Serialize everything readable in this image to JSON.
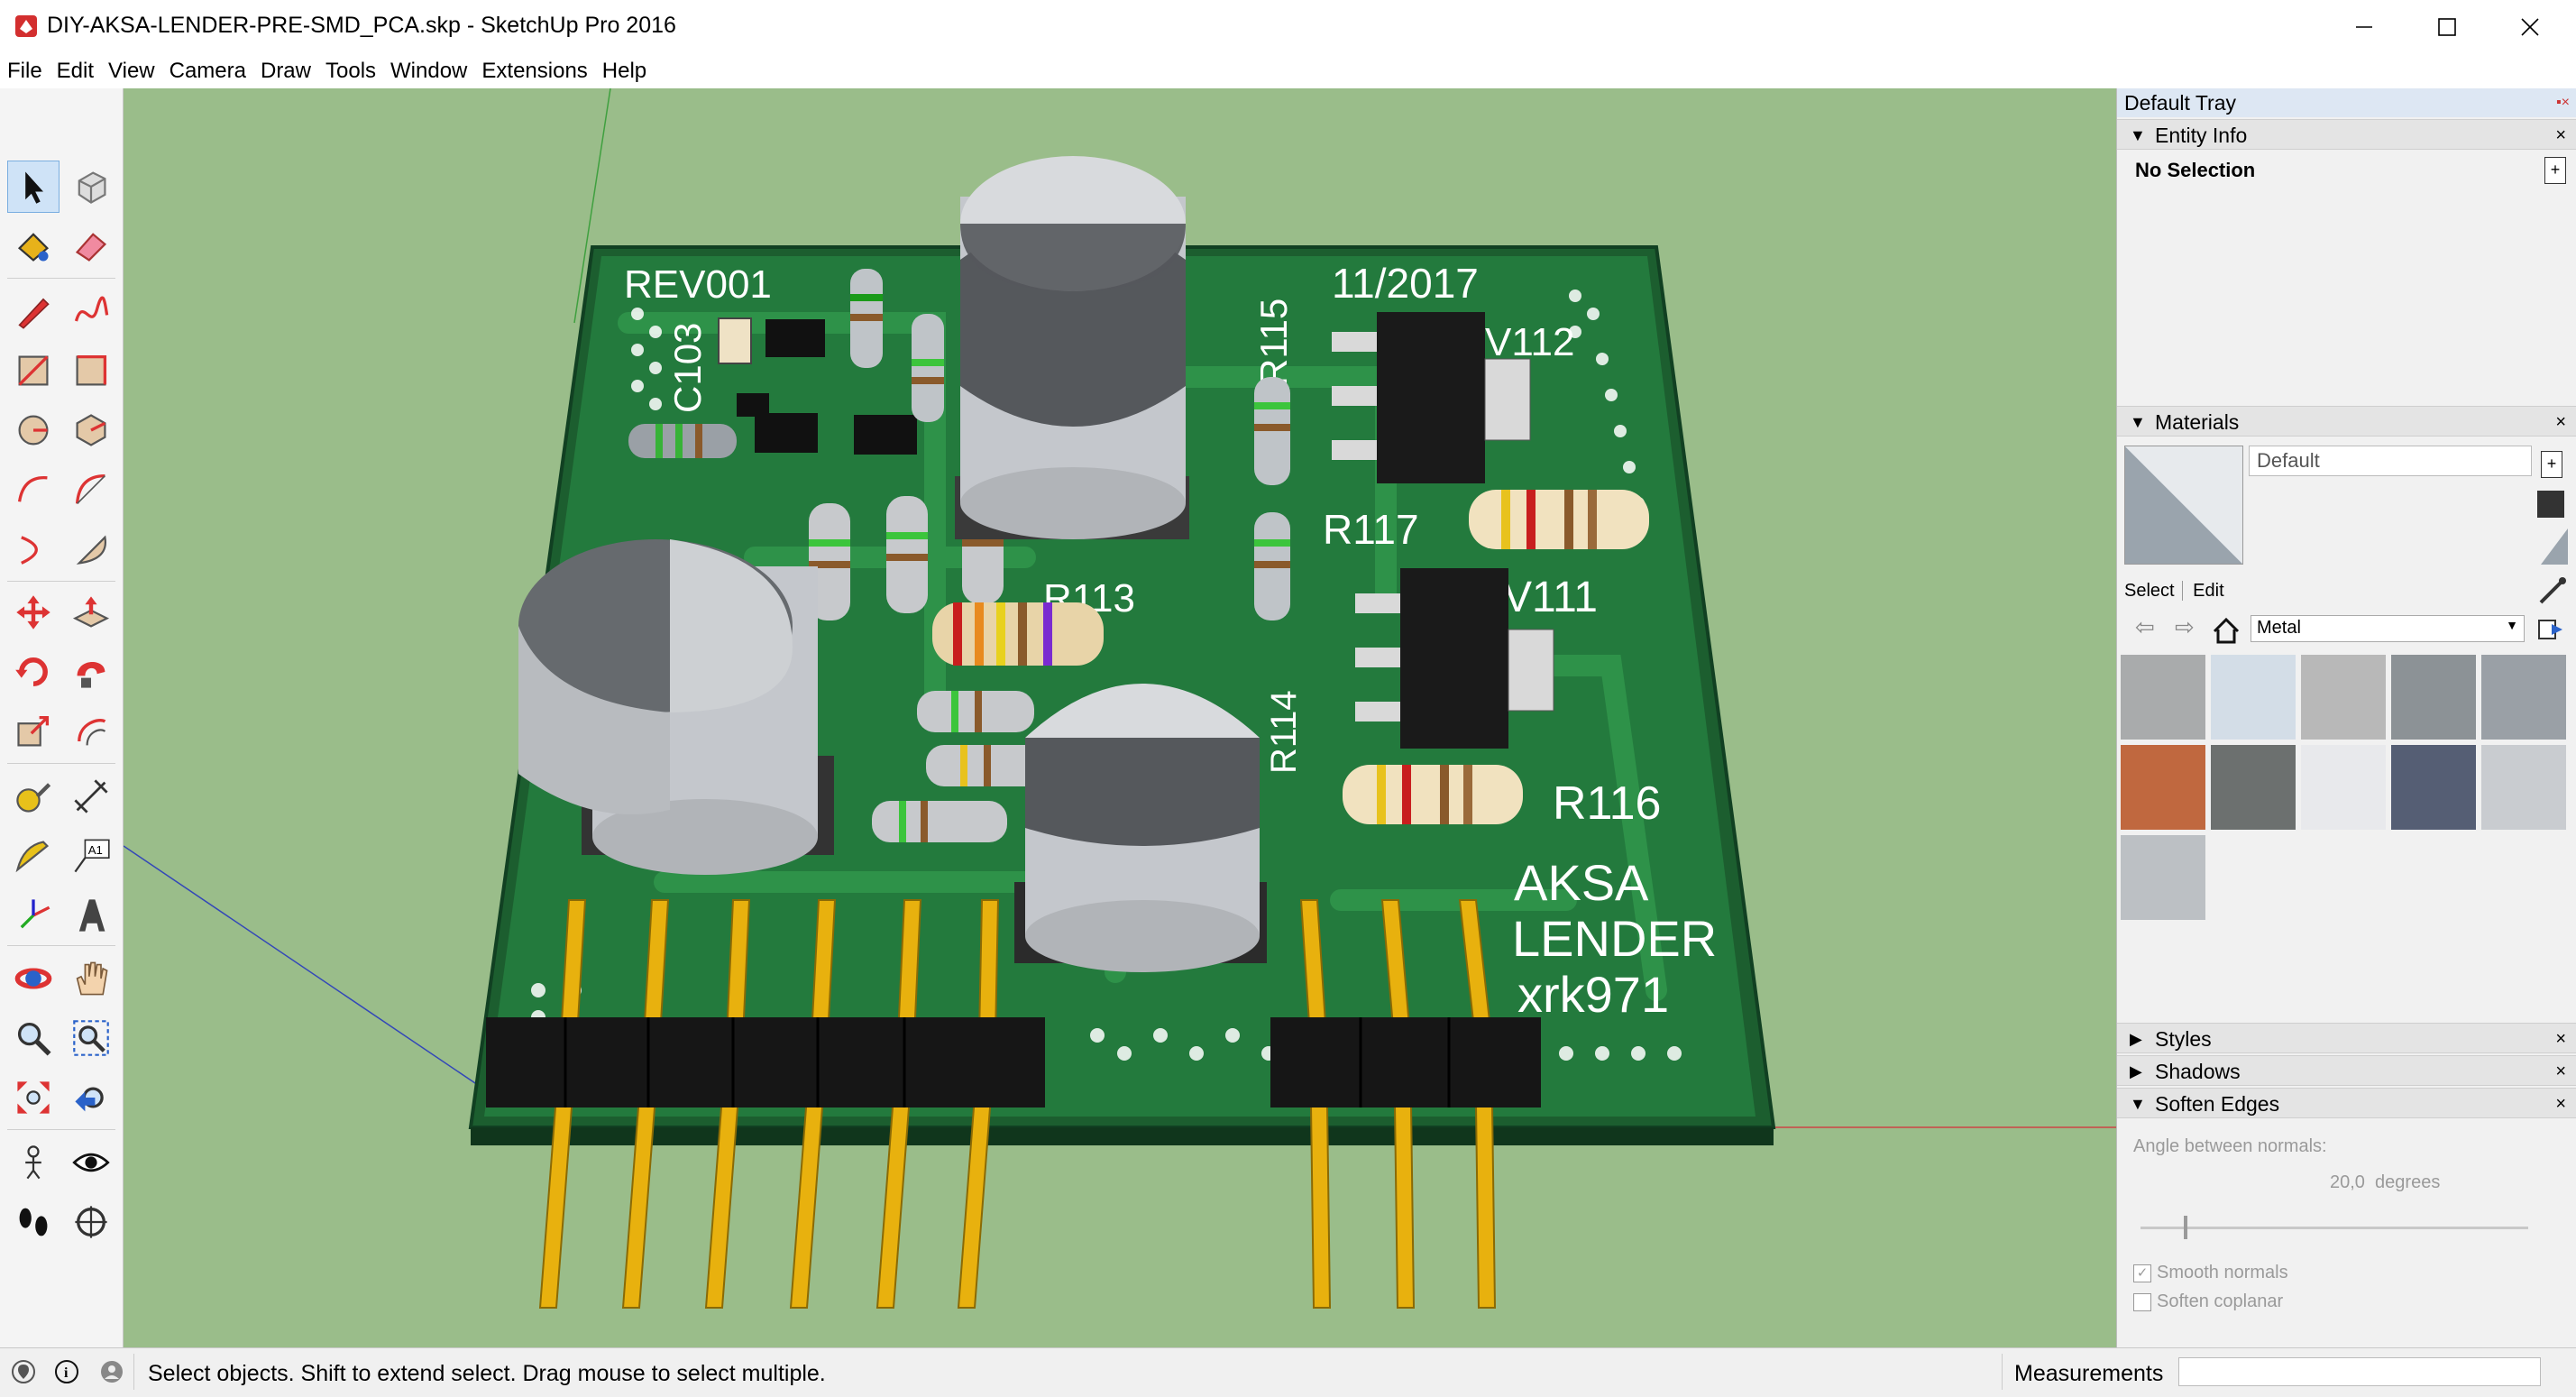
{
  "window": {
    "title": "DIY-AKSA-LENDER-PRE-SMD_PCA.skp - SketchUp Pro 2016",
    "minimize_glyph": "—",
    "maximize_glyph": "☐",
    "close_glyph": "✕"
  },
  "menu": [
    "File",
    "Edit",
    "View",
    "Camera",
    "Draw",
    "Tools",
    "Window",
    "Extensions",
    "Help"
  ],
  "toolbar": {
    "tools": [
      "select-tool",
      "component-tool",
      "paint-bucket-tool",
      "eraser-tool",
      "pencil-line-tool",
      "freehand-tool",
      "rectangle-tool",
      "rotated-rectangle-tool",
      "circle-tool",
      "polygon-tool",
      "arc-tool",
      "two-point-arc-tool",
      "three-point-arc-tool",
      "pie-tool",
      "move-tool",
      "push-pull-tool",
      "rotate-tool",
      "follow-me-tool",
      "scale-tool",
      "offset-tool",
      "tape-measure-tool",
      "dimension-tool",
      "protractor-tool",
      "text-tool",
      "axes-tool",
      "3d-text-tool",
      "orbit-tool",
      "pan-tool",
      "zoom-tool",
      "zoom-window-tool",
      "zoom-extents-tool",
      "previous-view-tool",
      "position-camera-tool",
      "look-around-tool",
      "walk-tool",
      "section-plane-tool"
    ],
    "text_tool_glyph": "A1"
  },
  "pcb": {
    "labels": [
      "REV001",
      "11/2017",
      "C103",
      "R115",
      "V112",
      "R117",
      "R113",
      "V111",
      "R116",
      "AKSA",
      "LENDER",
      "xrk971",
      "R114"
    ],
    "board_color": "#1f6b35",
    "mask_trace_color": "#2a8a45",
    "silkscreen_color": "#ffffff",
    "cap_body_color": "#c4c7cc",
    "cap_stripe_color": "#55585c",
    "header_color": "#161616",
    "pin_color": "#e8b10e"
  },
  "tray": {
    "title": "Default Tray",
    "entity_info": {
      "title": "Entity Info",
      "selection": "No Selection"
    },
    "materials": {
      "title": "Materials",
      "current_name": "Default",
      "tab_select": "Select",
      "tab_edit": "Edit",
      "library": "Metal",
      "swatch_colors": [
        "#a9abac",
        "#d3dde7",
        "#b8b8b8",
        "#8c9296",
        "#9aa0a6",
        "#c0683f",
        "#6c706f",
        "#e8e9ec",
        "#555e74",
        "#c9ccd0",
        "#bcc0c4"
      ]
    },
    "styles": {
      "title": "Styles"
    },
    "shadows": {
      "title": "Shadows"
    },
    "soften_edges": {
      "title": "Soften Edges",
      "angle_label": "Angle between normals:",
      "angle_value": "20,0  degrees",
      "angle_degrees": 20,
      "angle_max_degrees": 180,
      "smooth_normals": "Smooth normals",
      "smooth_normals_checked": true,
      "soften_coplanar": "Soften coplanar",
      "soften_coplanar_checked": false
    }
  },
  "status": {
    "hint": "Select objects. Shift to extend select. Drag mouse to select multiple.",
    "measurements_label": "Measurements",
    "info_glyph": "i"
  },
  "icons": {
    "geo-location": "geo-location-icon",
    "credits": "credits-icon",
    "user": "user-icon"
  }
}
